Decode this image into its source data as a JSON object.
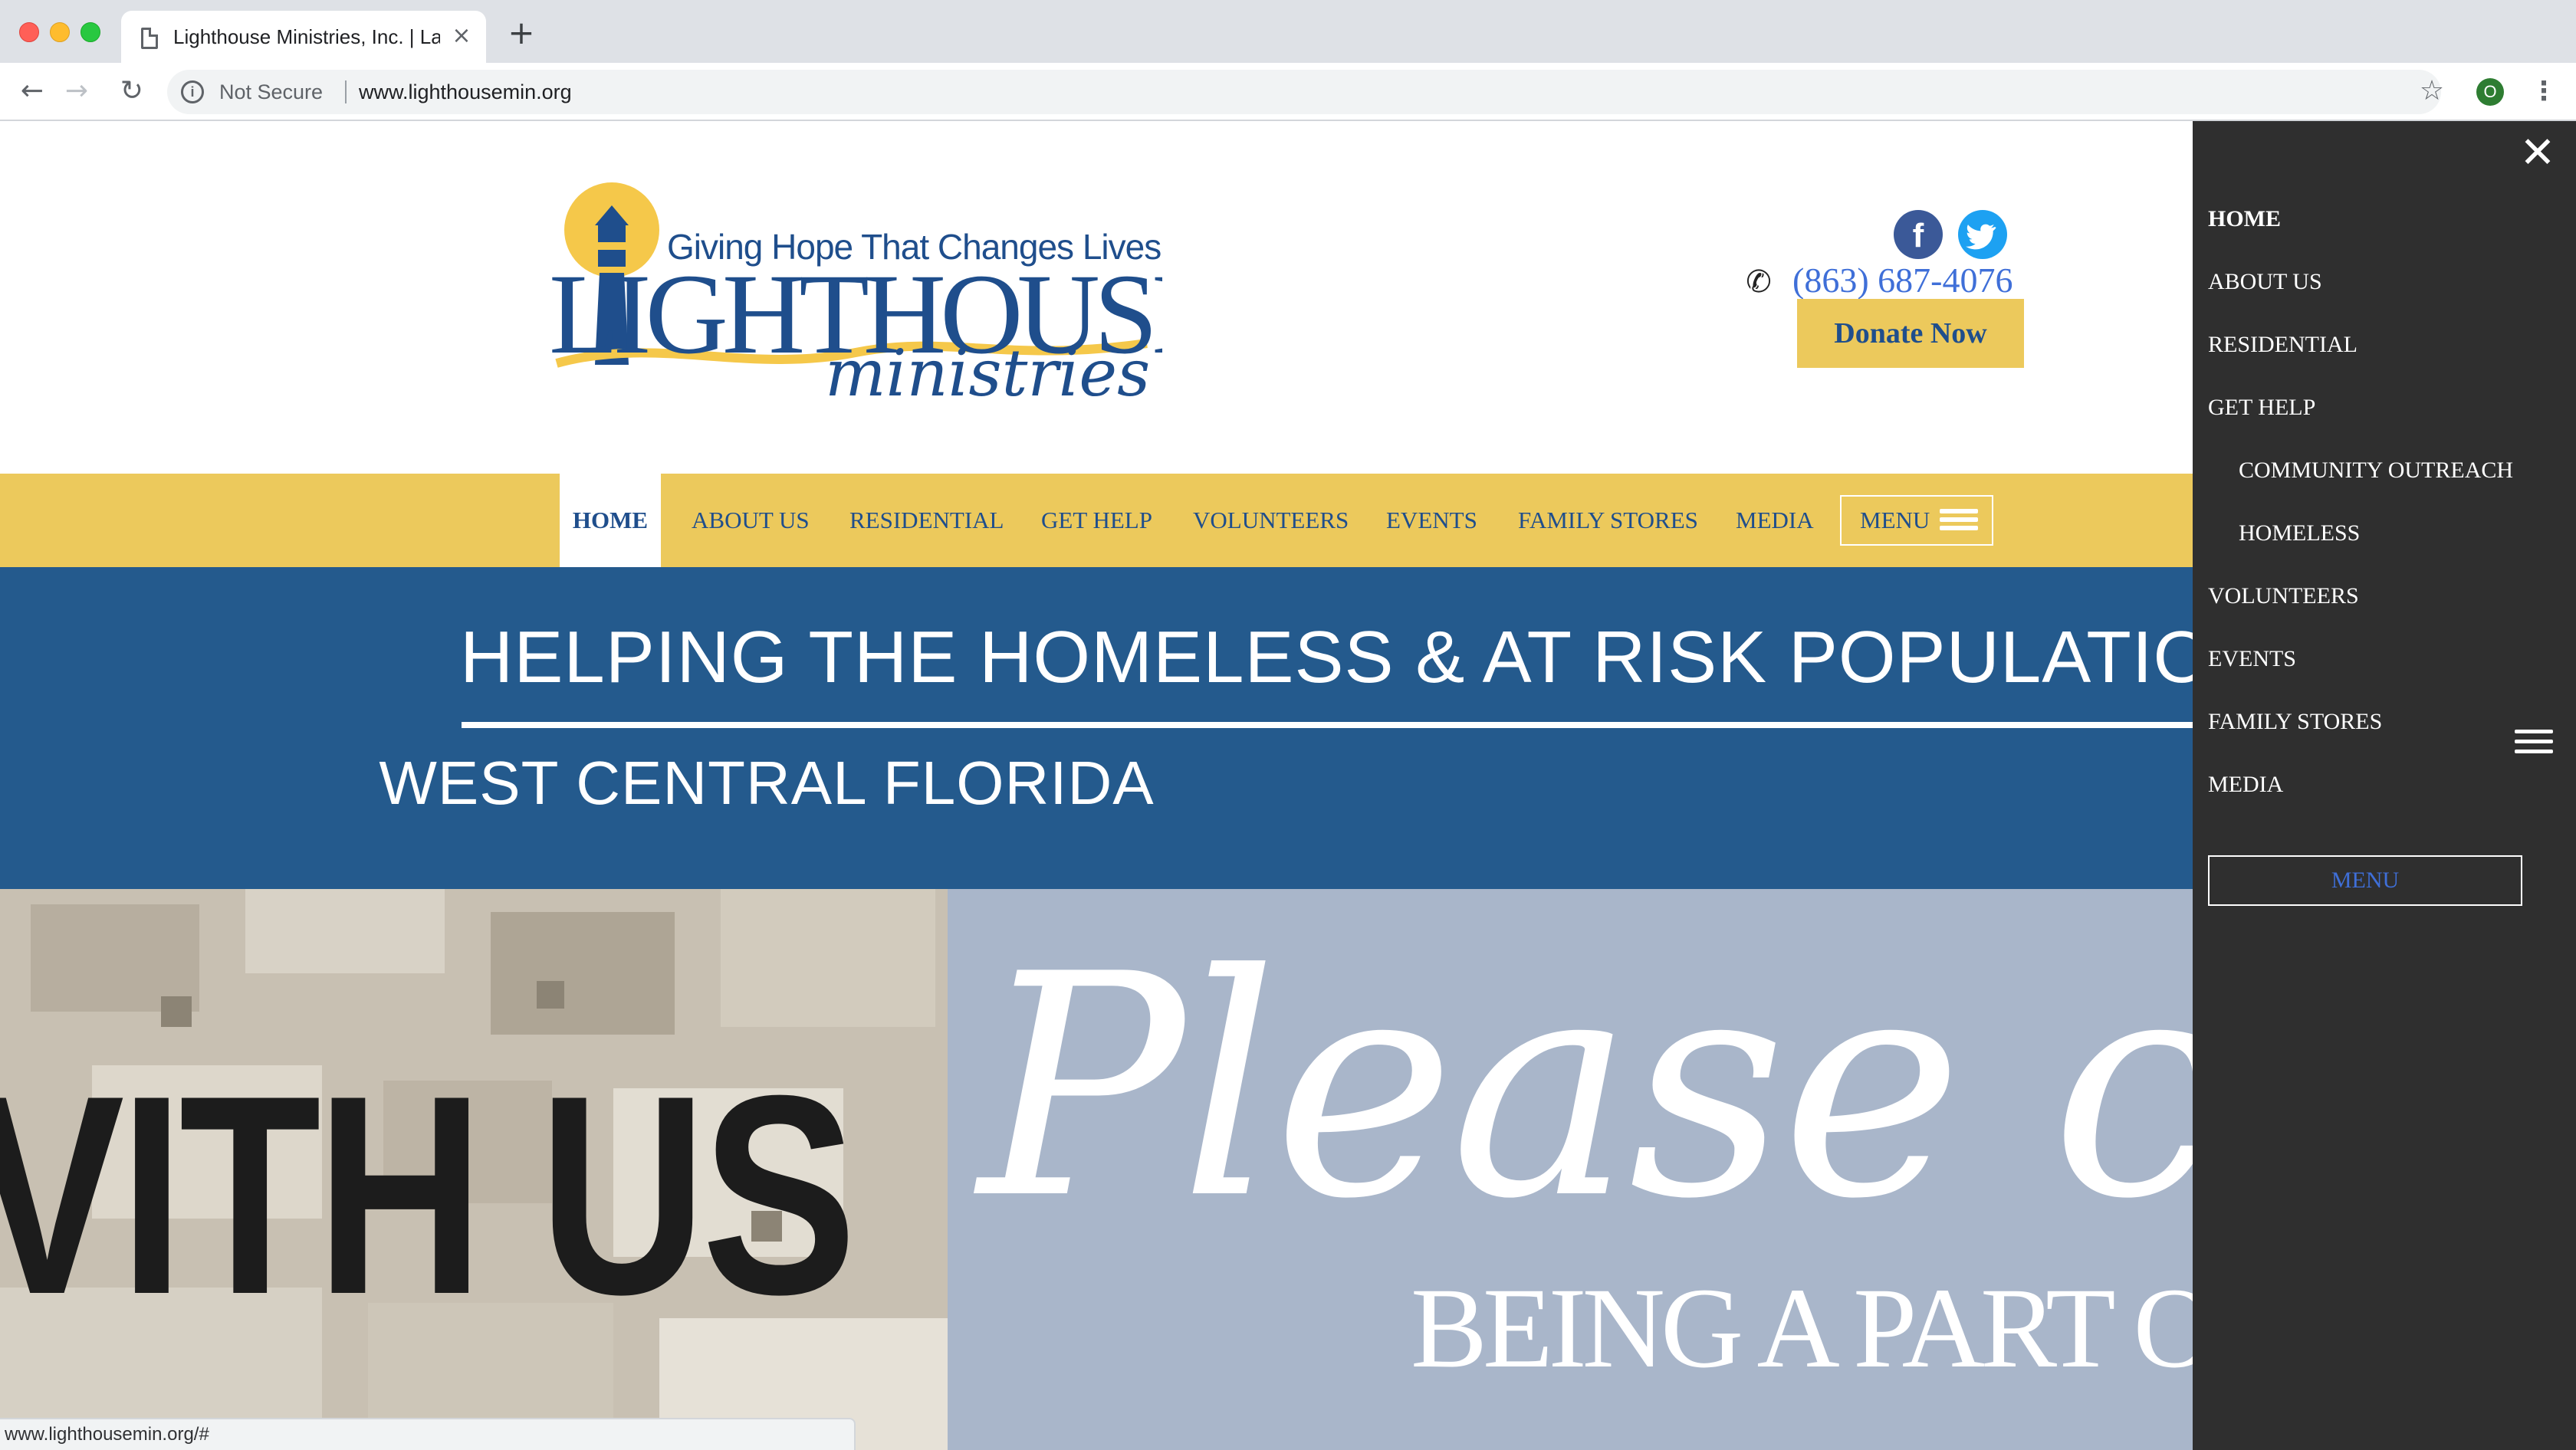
{
  "browser": {
    "tab_title": "Lighthouse Ministries, Inc. | Lakeland",
    "security_label": "Not Secure",
    "url": "www.lighthousemin.org",
    "profile_initial": "O",
    "status_url": "www.lighthousemin.org/#"
  },
  "header": {
    "tagline": "Giving Hope That Changes Lives",
    "logo_word_1": "LIGHTHOUSE",
    "logo_word_2": "ministries",
    "phone": "(863) 687-4076",
    "donate_label": "Donate Now",
    "social": [
      "facebook-icon",
      "twitter-icon"
    ]
  },
  "nav": {
    "items": [
      "HOME",
      "ABOUT US",
      "RESIDENTIAL",
      "GET HELP",
      "VOLUNTEERS",
      "EVENTS",
      "FAMILY STORES",
      "MEDIA"
    ],
    "active": "HOME",
    "menu_label": "MENU"
  },
  "hero": {
    "title": "HELPING THE HOMELESS & AT RISK POPULATION",
    "subtitle": "WEST CENTRAL FLORIDA"
  },
  "banner": {
    "photo_text": "VITH US",
    "script_text": "Please co",
    "caption": "BEING A PART O"
  },
  "side_menu": {
    "items": [
      "HOME",
      "ABOUT US",
      "RESIDENTIAL",
      "GET HELP",
      "COMMUNITY OUTREACH",
      "HOMELESS",
      "VOLUNTEERS",
      "EVENTS",
      "FAMILY STORES",
      "MEDIA"
    ],
    "menu_button": "MENU"
  },
  "colors": {
    "brand_blue": "#245a8d",
    "brand_gold": "#ecc95c",
    "link_blue": "#3f6fd8",
    "side_menu_bg": "#2f2f2f"
  }
}
